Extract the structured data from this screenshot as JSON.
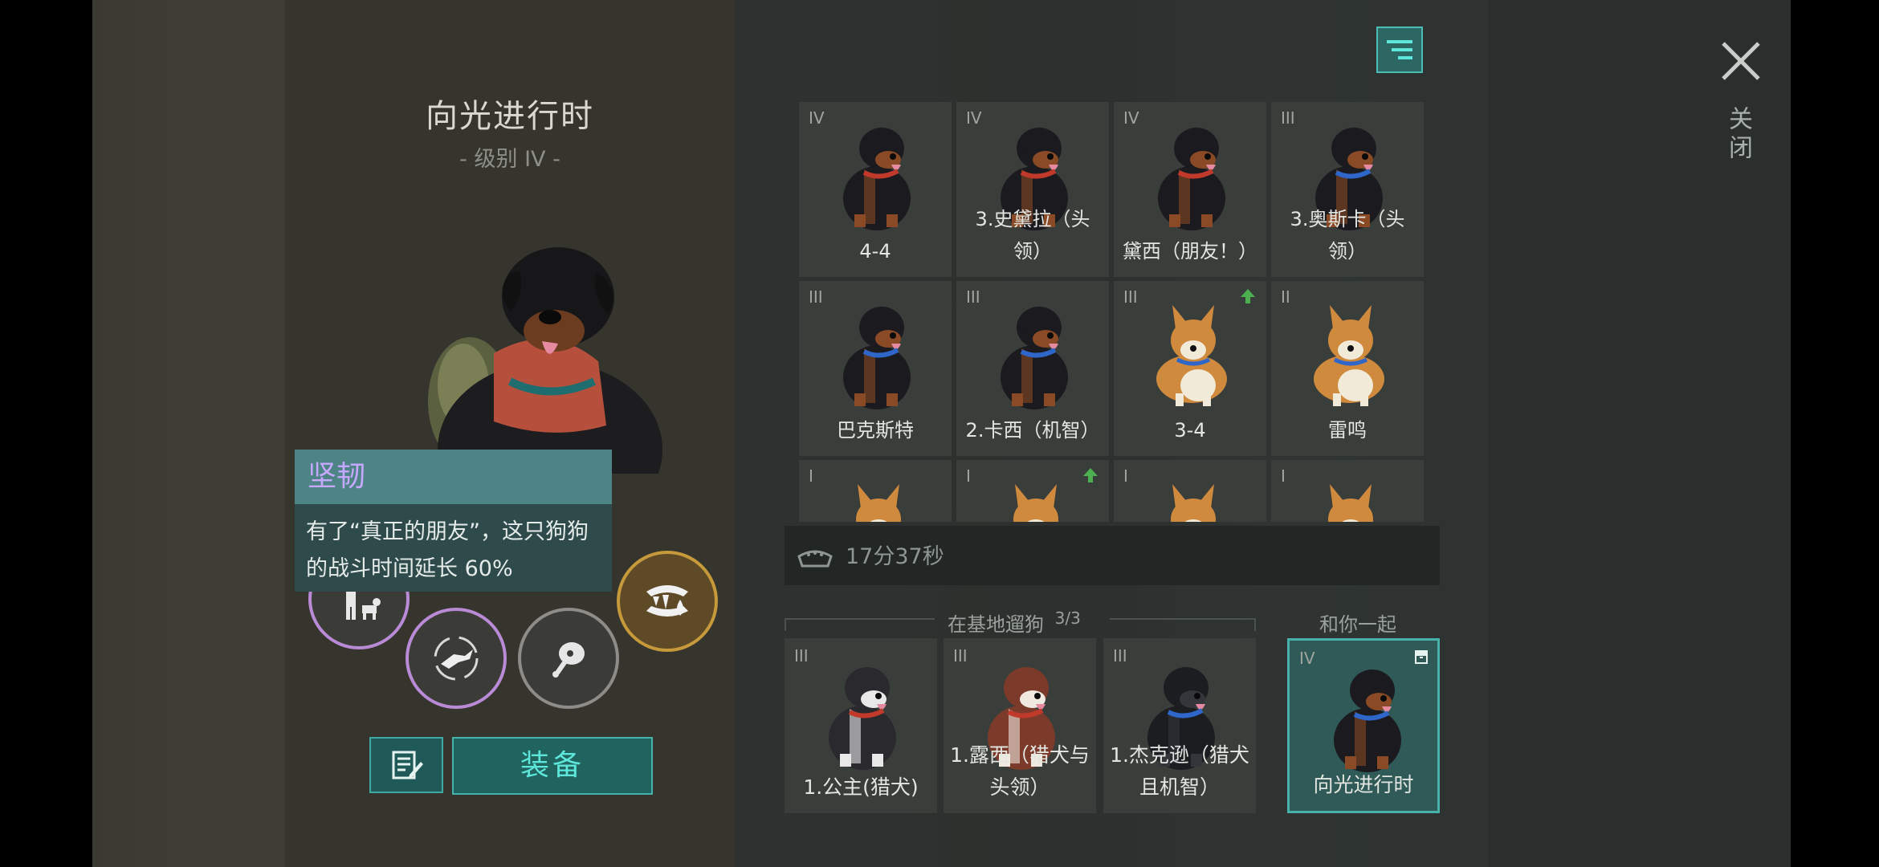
{
  "dog_detail": {
    "name": "向光进行时",
    "level": "- 级别 IV -"
  },
  "tooltip": {
    "title": "坚韧",
    "description": "有了“真正的朋友”，这只狗狗的战斗时间延长 60%"
  },
  "skills": [
    {
      "icon": "person-with-dog-icon"
    },
    {
      "icon": "dog-jump-cycle-icon"
    },
    {
      "icon": "meat-icon"
    },
    {
      "icon": "fang-blood-icon"
    }
  ],
  "actions": {
    "equip_label": "装备",
    "note_icon": "notepad-edit-icon"
  },
  "filter_icon": "filter-icon",
  "dog_grid": [
    {
      "tier": "IV",
      "name": "4-4",
      "breed": "rottweiler",
      "collar": "#c0392b",
      "upgrade": false
    },
    {
      "tier": "IV",
      "name": "3.史黛拉（头领）",
      "breed": "rottweiler",
      "collar": "#c0392b",
      "upgrade": false
    },
    {
      "tier": "IV",
      "name": "黛西（朋友！）",
      "breed": "rottweiler",
      "collar": "#c0392b",
      "upgrade": false
    },
    {
      "tier": "III",
      "name": "3.奥斯卡（头领）",
      "breed": "rottweiler",
      "collar": "#2e66c9",
      "upgrade": false
    },
    {
      "tier": "III",
      "name": "巴克斯特",
      "breed": "rottweiler",
      "collar": "#2e66c9",
      "upgrade": false
    },
    {
      "tier": "III",
      "name": "2.卡西（机智）",
      "breed": "rottweiler",
      "collar": "#2e66c9",
      "upgrade": false
    },
    {
      "tier": "III",
      "name": "3-4",
      "breed": "corgi",
      "collar": "#2e66c9",
      "upgrade": true
    },
    {
      "tier": "II",
      "name": "雷鸣",
      "breed": "corgi",
      "collar": "#2e66c9",
      "upgrade": false
    },
    {
      "tier": "I",
      "name": "",
      "breed": "corgi",
      "collar": "#2e66c9",
      "upgrade": false
    },
    {
      "tier": "I",
      "name": "",
      "breed": "corgi",
      "collar": "#2e66c9",
      "upgrade": true
    },
    {
      "tier": "I",
      "name": "",
      "breed": "corgi",
      "collar": "#2e66c9",
      "upgrade": false
    },
    {
      "tier": "I",
      "name": "",
      "breed": "corgi",
      "collar": "#2e66c9",
      "upgrade": false
    }
  ],
  "timer": {
    "icon": "food-bowl-icon",
    "text": "17分37秒"
  },
  "base_walk": {
    "label": "在基地遛狗",
    "count": "3/3",
    "dogs": [
      {
        "tier": "III",
        "name": "1.公主(猎犬)",
        "breed": "husky",
        "collar": "#c0392b"
      },
      {
        "tier": "III",
        "name": "1.露西（猎犬与头领）",
        "breed": "husky-red",
        "collar": "#c0392b"
      },
      {
        "tier": "III",
        "name": "1.杰克逊（猎犬且机智）",
        "breed": "shepherd",
        "collar": "#2e66c9"
      }
    ]
  },
  "with_you": {
    "label": "和你一起",
    "dog": {
      "tier": "IV",
      "name": "向光进行时",
      "breed": "rottweiler",
      "collar": "#2e66c9"
    }
  },
  "close": {
    "label": "关闭",
    "icon": "close-icon"
  }
}
